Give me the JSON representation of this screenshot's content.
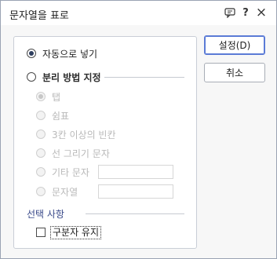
{
  "dialog": {
    "title": "문자열을 표로",
    "help_icon": "help-icon",
    "help_label": "?",
    "close_label": "×"
  },
  "options": {
    "auto_label": "자동으로 넣기",
    "separator_label": "분리 방법 지정",
    "tab_label": "탭",
    "comma_label": "쉼표",
    "spaces_label": "3칸 이상의 빈칸",
    "linedraw_label": "선 그리기 문자",
    "other_label": "기타 문자",
    "string_label": "문자열",
    "other_value": "",
    "string_value": ""
  },
  "select": {
    "section_label": "선택 사항",
    "keep_separator_label": "구분자 유지"
  },
  "buttons": {
    "ok_label": "설정(D)",
    "cancel_label": "취소"
  },
  "colors": {
    "accent": "#5b7bd6",
    "section_text": "#3a4a8a"
  }
}
